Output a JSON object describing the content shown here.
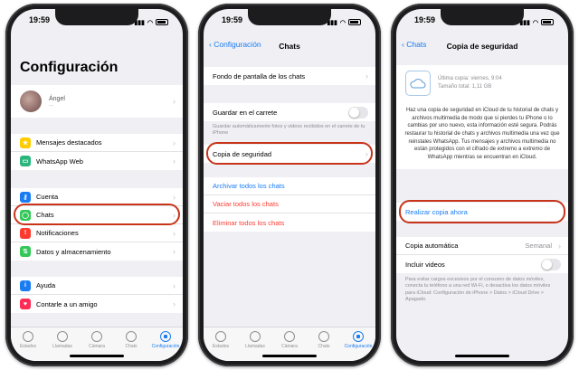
{
  "status_time": "19:59",
  "colors": {
    "accent": "#1a7cf2",
    "destructive": "#ff3b30",
    "highlight": "#c8341a"
  },
  "tabs": [
    {
      "label": "Estados",
      "icon": "status-icon"
    },
    {
      "label": "Llamadas",
      "icon": "phone-icon"
    },
    {
      "label": "Cámara",
      "icon": "camera-icon"
    },
    {
      "label": "Chats",
      "icon": "chat-icon"
    },
    {
      "label": "Configuración",
      "icon": "settings-icon"
    }
  ],
  "phone1": {
    "title": "Configuración",
    "profile": {
      "name": "Ángel",
      "status": "..."
    },
    "group1": [
      "Mensajes destacados",
      "WhatsApp Web"
    ],
    "group2": [
      "Cuenta",
      "Chats",
      "Notificaciones",
      "Datos y almacenamiento"
    ],
    "group3": [
      "Ayuda",
      "Contarle a un amigo"
    ]
  },
  "phone2": {
    "back": "Configuración",
    "title": "Chats",
    "wallpaper": "Fondo de pantalla de los chats",
    "save_roll": "Guardar en el carrete",
    "save_roll_note": "Guardar automáticamente fotos y videos recibidos en el carrete de tu iPhone",
    "backup": "Copia de seguridad",
    "archive_all": "Archivar todos los chats",
    "clear_all": "Vaciar todos los chats",
    "delete_all": "Eliminar todos los chats"
  },
  "phone3": {
    "back": "Chats",
    "title": "Copia de seguridad",
    "last_backup": "Última copia: viernes, 9:04",
    "total_size": "Tamaño total: 1,11 GB",
    "description": "Haz una copia de seguridad en iCloud de tu historial de chats y archivos multimedia de modo que si pierdes tu iPhone o lo cambias por uno nuevo, esta información esté segura. Podrás restaurar tu historial de chats y archivos multimedia una vez que reinstales WhatsApp. Tus mensajes y archivos multimedia no están protegidos con el cifrado de extremo a extremo de WhatsApp mientras se encuentran en iCloud.",
    "backup_now": "Realizar copia ahora",
    "auto_backup": "Copia automática",
    "auto_backup_value": "Semanal",
    "include_videos": "Incluir videos",
    "note": "Para evitar cargos excesivos por el consumo de datos móviles, conecta tu teléfono a una red Wi-Fi, o desactiva los datos móviles para iCloud: Configuración de iPhone > Datos > iCloud Drive > Apagado."
  }
}
